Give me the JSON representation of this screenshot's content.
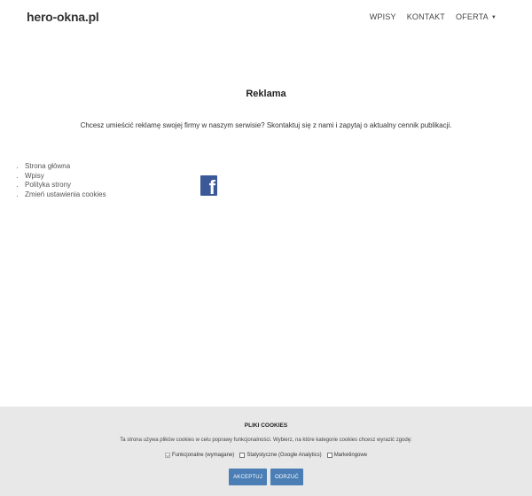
{
  "header": {
    "logo": "hero-okna.pl",
    "nav": {
      "wpisy": "WPISY",
      "kontakt": "KONTAKT",
      "oferta": "OFERTA",
      "oferta_caret": "▼"
    }
  },
  "main": {
    "title": "Reklama",
    "intro": "Chcesz umieścić reklamę swojej firmy w naszym serwisie? Skontaktuj się z nami i zapytaj o aktualny cennik publikacji."
  },
  "footer": {
    "links": [
      "Strona główna",
      "Wpisy",
      "Polityka strony",
      "Zmień ustawienia cookies"
    ],
    "social_icon": "facebook-icon",
    "social_glyph": "f",
    "social_color": "#3b5998"
  },
  "cookie_banner": {
    "title": "PLIKI COOKIES",
    "text": "Ta strona używa plików cookies w celu poprawy funkcjonalności. Wybierz, na które kategorie cookies chcesz wyrazić zgodę:",
    "options": [
      {
        "label": "Funkcjonalne (wymagane)",
        "checked": true,
        "disabled": true
      },
      {
        "label": "Statystyczne (Google Analytics)",
        "checked": false,
        "disabled": false
      },
      {
        "label": "Marketingowe",
        "checked": false,
        "disabled": false
      }
    ],
    "accept_label": "AKCEPTUJ",
    "reject_label": "ODRZUĆ",
    "background": "#e8e8e8",
    "button_color": "#4a7eb5"
  }
}
